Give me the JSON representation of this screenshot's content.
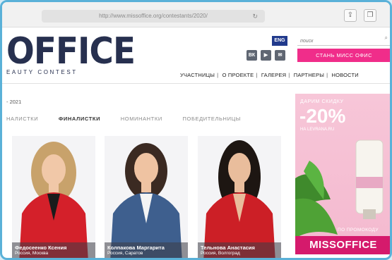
{
  "browser": {
    "url": "http://www.missoffice.org/contestants/2020/",
    "reload_icon": "reload-icon",
    "share_icon": "share-icon",
    "tabs_icon": "tabs-icon"
  },
  "header": {
    "logo_text": "OFFICE",
    "tagline": "EAUTY CONTEST",
    "lang_label": "ENG",
    "search_placeholder": "поиск",
    "cta_label": "СТАНЬ МИСС ОФИС",
    "social": [
      "ВК",
      "▶",
      "✉"
    ]
  },
  "nav": {
    "items": [
      "УЧАСТНИЦЫ",
      "О ПРОЕКТЕ",
      "ГАЛЕРЕЯ",
      "ПАРТНЕРЫ",
      "НОВОСТИ"
    ]
  },
  "main": {
    "breadcrumb": "- 2021",
    "tabs": [
      "НАЛИСТКИ",
      "ФИНАЛИСТКИ",
      "НОМИНАНТКИ",
      "ПОБЕДИТЕЛЬНИЦЫ"
    ],
    "active_tab": 1,
    "cards": [
      {
        "name": "Федосеенко Ксения",
        "city": "Россия, Москва",
        "jacket": "#d4202a",
        "hair": "#c8a26b"
      },
      {
        "name": "Колпакова Маргарита",
        "city": "Россия, Саратов",
        "jacket": "#3e5f8e",
        "hair": "#3b2a22"
      },
      {
        "name": "Тельнова Анастасия",
        "city": "Россия, Волгоград",
        "jacket": "#cc1f26",
        "hair": "#1d1612"
      }
    ]
  },
  "ad": {
    "headline": "ДАРИМ СКИДКУ",
    "discount": "-20%",
    "site": "НА LEVRANA.RU",
    "promo": "ПО ПРОМОКОДУ",
    "brand": "MISSOFFICE"
  },
  "colors": {
    "frame": "#5ab1d8",
    "logo": "#27304f",
    "cta": "#f02d8a",
    "ad_brand": "#d51a6c"
  }
}
